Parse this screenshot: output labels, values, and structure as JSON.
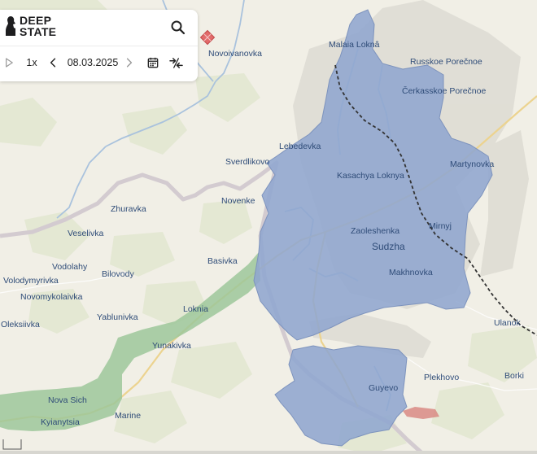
{
  "app": {
    "brand_line1": "DEEP",
    "brand_line2": "STATE",
    "speed": "1x",
    "date": "08.03.2025",
    "icons": [
      "deepstate-logo-icon",
      "search-icon",
      "play-icon",
      "chevron-left-icon",
      "chevron-right-icon",
      "calendar-icon",
      "compare-icon"
    ]
  },
  "colors": {
    "occupied": "#8fa6cf",
    "liberated": "#9dc79a",
    "border_line": "#333333",
    "label": "#2f4c78",
    "land": "#f1efe6"
  },
  "places": {
    "novoivanovka": "Novoivanovka",
    "malaia_lokna": "Malaia Loknâ",
    "russkoe_porechnoe": "Russkoe Porečnoe",
    "cherkasskoe_porechnoe": "Čerkasskoe Porečnoe",
    "lebedevka": "Lebedevka",
    "sverdlikovo": "Sverdlikovo",
    "kasachya_loknya": "Kasachya Loknya",
    "martynovka": "Martynovka",
    "novenke": "Novenke",
    "zhuravka": "Zhuravka",
    "mirnyj": "Mirnyj",
    "veselivka": "Veselivka",
    "zaoleshenka": "Zaoleshenka",
    "sudzha": "Sudzha",
    "basivka": "Basivka",
    "vodolahy": "Vodolahy",
    "bilovody": "Bilovody",
    "makhnovka": "Makhnovka",
    "volodymyrivka": "Volodymyrivka",
    "novomykolaivka": "Novomykolaivka",
    "yablunivka": "Yablunivka",
    "loknia": "Loknia",
    "ulanok": "Ulanok",
    "oleksiivka": "Oleksiivka",
    "yunakivka": "Yunakivka",
    "plekhovo": "Plekhovo",
    "borki": "Borki",
    "guyevo": "Guyevo",
    "nova_sich": "Nova Sich",
    "kyianytsia": "Kyianytsia",
    "marine": "Marine"
  }
}
